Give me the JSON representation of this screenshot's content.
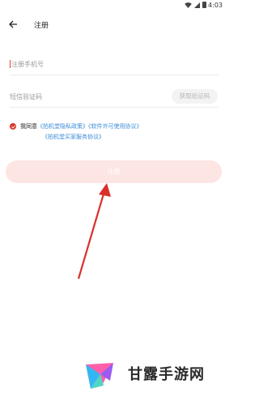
{
  "status_bar": {
    "time": "4:03"
  },
  "header": {
    "title": "注册"
  },
  "form": {
    "phone_placeholder": "注册手机号",
    "code_placeholder": "短信验证码",
    "get_code_label": "获取验证码"
  },
  "agreement": {
    "prefix": "我同意",
    "privacy_link": "《拍机堂隐私政策》",
    "license_link": "《软件许可使用协议》",
    "service_link": "《拍机堂买家服务协议》"
  },
  "register_label": "注册",
  "watermark": {
    "text": "甘露手游网"
  },
  "colors": {
    "accent": "#d93a2b",
    "link": "#3b8bd8",
    "button_disabled": "#fde5e3"
  },
  "icons": [
    "wifi-icon",
    "signal-icon",
    "battery-icon",
    "back-arrow-icon",
    "check-icon",
    "watermark-logo-icon"
  ]
}
